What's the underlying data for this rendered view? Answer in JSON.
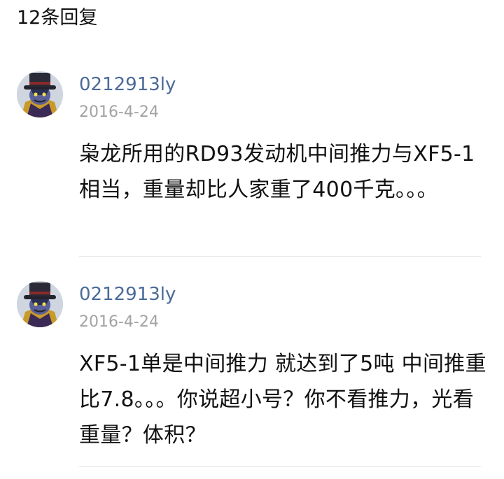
{
  "header": {
    "reply_count": "12条回复"
  },
  "comments": [
    {
      "username": "0212913ly",
      "date": "2016-4-24",
      "text": "枭龙所用的RD93发动机中间推力与XF5-1相当，重量却比人家重了400千克。。。",
      "avatar_icon": "villain-avatar-icon"
    },
    {
      "username": "0212913ly",
      "date": "2016-4-24",
      "text": "XF5-1单是中间推力 就达到了5吨 中间推重比7.8。。。你说超小号？你不看推力，光看重量？体积？",
      "avatar_icon": "villain-avatar-icon"
    }
  ],
  "colors": {
    "username": "#4a6a99",
    "date": "#a3a3a3",
    "text": "#111111",
    "divider": "#e6e6e6"
  }
}
